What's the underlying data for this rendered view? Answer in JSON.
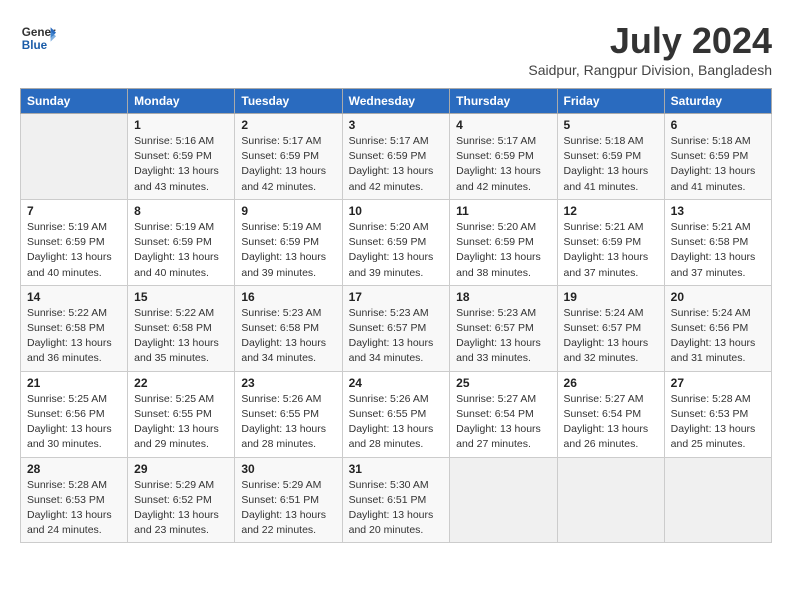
{
  "header": {
    "logo_line1": "General",
    "logo_line2": "Blue",
    "title": "July 2024",
    "location": "Saidpur, Rangpur Division, Bangladesh"
  },
  "calendar": {
    "days_of_week": [
      "Sunday",
      "Monday",
      "Tuesday",
      "Wednesday",
      "Thursday",
      "Friday",
      "Saturday"
    ],
    "weeks": [
      [
        {
          "day": "",
          "info": ""
        },
        {
          "day": "1",
          "info": "Sunrise: 5:16 AM\nSunset: 6:59 PM\nDaylight: 13 hours\nand 43 minutes."
        },
        {
          "day": "2",
          "info": "Sunrise: 5:17 AM\nSunset: 6:59 PM\nDaylight: 13 hours\nand 42 minutes."
        },
        {
          "day": "3",
          "info": "Sunrise: 5:17 AM\nSunset: 6:59 PM\nDaylight: 13 hours\nand 42 minutes."
        },
        {
          "day": "4",
          "info": "Sunrise: 5:17 AM\nSunset: 6:59 PM\nDaylight: 13 hours\nand 42 minutes."
        },
        {
          "day": "5",
          "info": "Sunrise: 5:18 AM\nSunset: 6:59 PM\nDaylight: 13 hours\nand 41 minutes."
        },
        {
          "day": "6",
          "info": "Sunrise: 5:18 AM\nSunset: 6:59 PM\nDaylight: 13 hours\nand 41 minutes."
        }
      ],
      [
        {
          "day": "7",
          "info": "Sunrise: 5:19 AM\nSunset: 6:59 PM\nDaylight: 13 hours\nand 40 minutes."
        },
        {
          "day": "8",
          "info": "Sunrise: 5:19 AM\nSunset: 6:59 PM\nDaylight: 13 hours\nand 40 minutes."
        },
        {
          "day": "9",
          "info": "Sunrise: 5:19 AM\nSunset: 6:59 PM\nDaylight: 13 hours\nand 39 minutes."
        },
        {
          "day": "10",
          "info": "Sunrise: 5:20 AM\nSunset: 6:59 PM\nDaylight: 13 hours\nand 39 minutes."
        },
        {
          "day": "11",
          "info": "Sunrise: 5:20 AM\nSunset: 6:59 PM\nDaylight: 13 hours\nand 38 minutes."
        },
        {
          "day": "12",
          "info": "Sunrise: 5:21 AM\nSunset: 6:59 PM\nDaylight: 13 hours\nand 37 minutes."
        },
        {
          "day": "13",
          "info": "Sunrise: 5:21 AM\nSunset: 6:58 PM\nDaylight: 13 hours\nand 37 minutes."
        }
      ],
      [
        {
          "day": "14",
          "info": "Sunrise: 5:22 AM\nSunset: 6:58 PM\nDaylight: 13 hours\nand 36 minutes."
        },
        {
          "day": "15",
          "info": "Sunrise: 5:22 AM\nSunset: 6:58 PM\nDaylight: 13 hours\nand 35 minutes."
        },
        {
          "day": "16",
          "info": "Sunrise: 5:23 AM\nSunset: 6:58 PM\nDaylight: 13 hours\nand 34 minutes."
        },
        {
          "day": "17",
          "info": "Sunrise: 5:23 AM\nSunset: 6:57 PM\nDaylight: 13 hours\nand 34 minutes."
        },
        {
          "day": "18",
          "info": "Sunrise: 5:23 AM\nSunset: 6:57 PM\nDaylight: 13 hours\nand 33 minutes."
        },
        {
          "day": "19",
          "info": "Sunrise: 5:24 AM\nSunset: 6:57 PM\nDaylight: 13 hours\nand 32 minutes."
        },
        {
          "day": "20",
          "info": "Sunrise: 5:24 AM\nSunset: 6:56 PM\nDaylight: 13 hours\nand 31 minutes."
        }
      ],
      [
        {
          "day": "21",
          "info": "Sunrise: 5:25 AM\nSunset: 6:56 PM\nDaylight: 13 hours\nand 30 minutes."
        },
        {
          "day": "22",
          "info": "Sunrise: 5:25 AM\nSunset: 6:55 PM\nDaylight: 13 hours\nand 29 minutes."
        },
        {
          "day": "23",
          "info": "Sunrise: 5:26 AM\nSunset: 6:55 PM\nDaylight: 13 hours\nand 28 minutes."
        },
        {
          "day": "24",
          "info": "Sunrise: 5:26 AM\nSunset: 6:55 PM\nDaylight: 13 hours\nand 28 minutes."
        },
        {
          "day": "25",
          "info": "Sunrise: 5:27 AM\nSunset: 6:54 PM\nDaylight: 13 hours\nand 27 minutes."
        },
        {
          "day": "26",
          "info": "Sunrise: 5:27 AM\nSunset: 6:54 PM\nDaylight: 13 hours\nand 26 minutes."
        },
        {
          "day": "27",
          "info": "Sunrise: 5:28 AM\nSunset: 6:53 PM\nDaylight: 13 hours\nand 25 minutes."
        }
      ],
      [
        {
          "day": "28",
          "info": "Sunrise: 5:28 AM\nSunset: 6:53 PM\nDaylight: 13 hours\nand 24 minutes."
        },
        {
          "day": "29",
          "info": "Sunrise: 5:29 AM\nSunset: 6:52 PM\nDaylight: 13 hours\nand 23 minutes."
        },
        {
          "day": "30",
          "info": "Sunrise: 5:29 AM\nSunset: 6:51 PM\nDaylight: 13 hours\nand 22 minutes."
        },
        {
          "day": "31",
          "info": "Sunrise: 5:30 AM\nSunset: 6:51 PM\nDaylight: 13 hours\nand 20 minutes."
        },
        {
          "day": "",
          "info": ""
        },
        {
          "day": "",
          "info": ""
        },
        {
          "day": "",
          "info": ""
        }
      ]
    ]
  }
}
